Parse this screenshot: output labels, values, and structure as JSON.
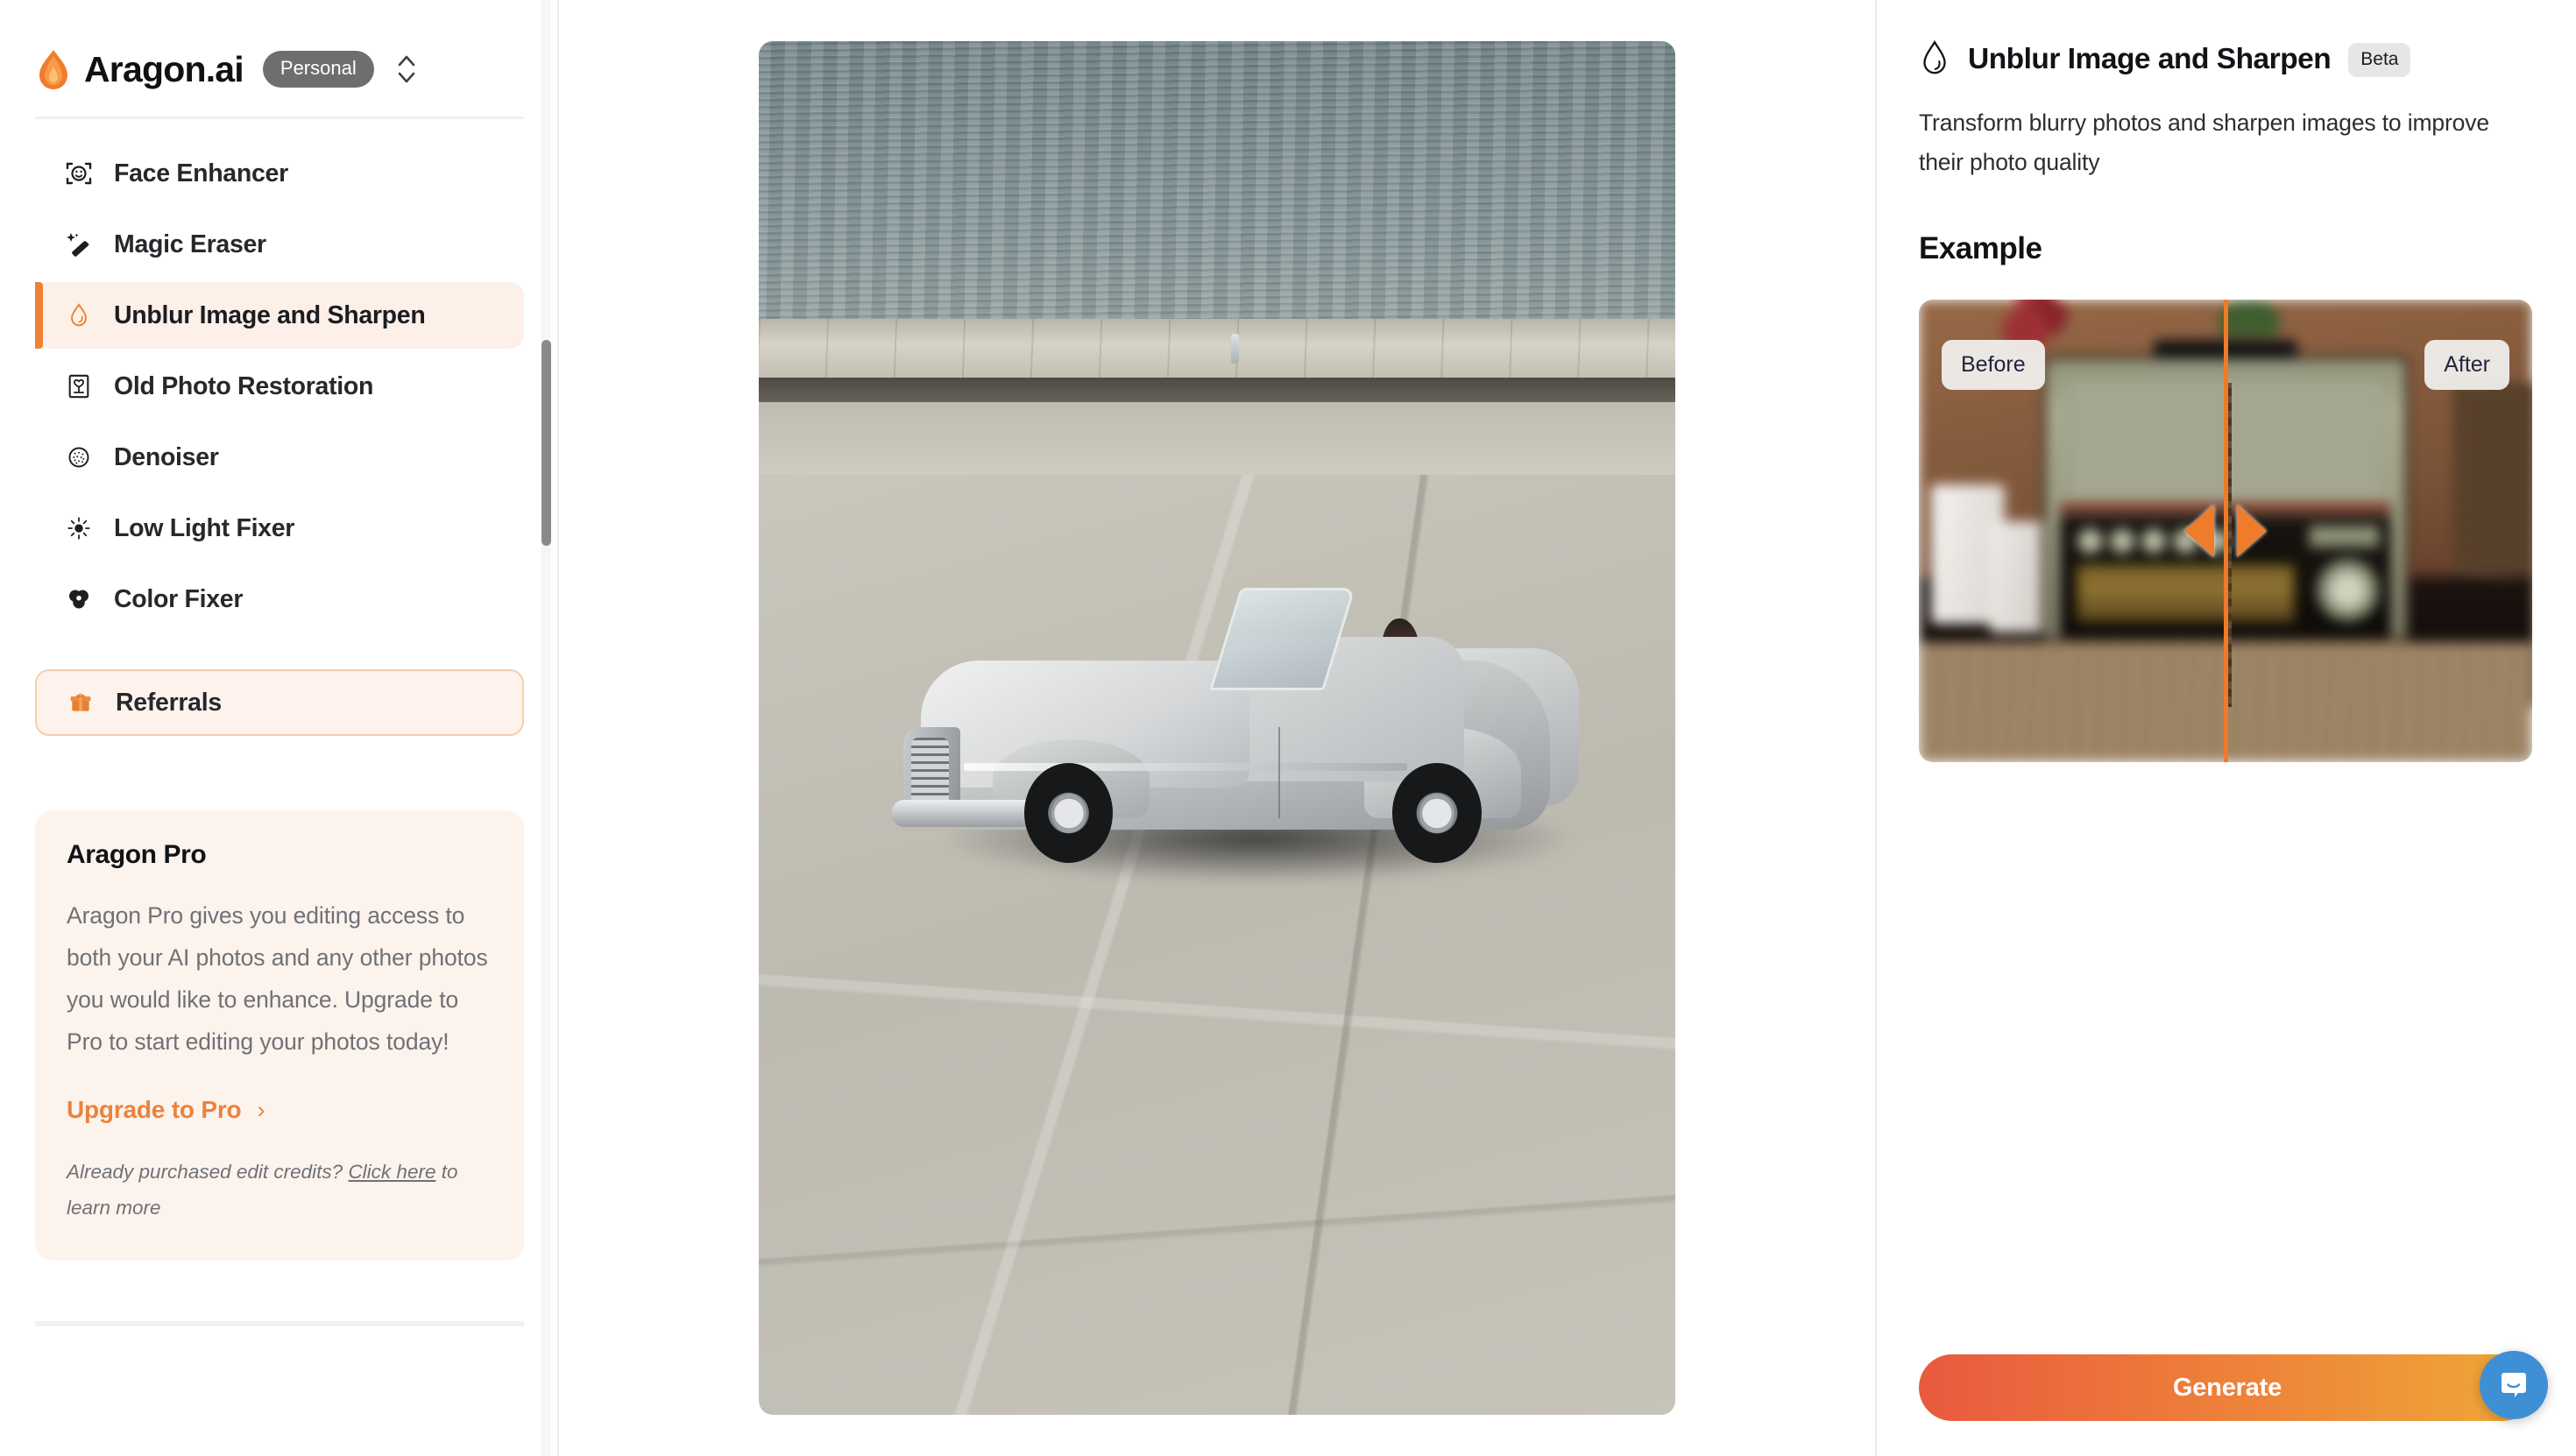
{
  "sidebar": {
    "brand": {
      "name": "Aragon.ai",
      "logo_icon": "flame-icon",
      "plan_badge": "Personal",
      "switcher_icon": "chevron-up-down-icon"
    },
    "nav_items": [
      {
        "label": "Face Enhancer",
        "icon": "face-scan-icon",
        "active": false
      },
      {
        "label": "Magic Eraser",
        "icon": "magic-wand-icon",
        "active": false
      },
      {
        "label": "Unblur Image and Sharpen",
        "icon": "water-drop-icon",
        "active": true
      },
      {
        "label": "Old Photo Restoration",
        "icon": "framed-flower-photo-icon",
        "active": false
      },
      {
        "label": "Denoiser",
        "icon": "noise-circle-icon",
        "active": false
      },
      {
        "label": "Low Light Fixer",
        "icon": "sun-icon",
        "active": false
      },
      {
        "label": "Color Fixer",
        "icon": "color-wheel-icon",
        "active": false
      }
    ],
    "referrals": {
      "label": "Referrals",
      "icon": "gift-icon"
    },
    "pro_card": {
      "title": "Aragon Pro",
      "body": "Aragon Pro gives you editing access to both your AI photos and any other photos you would like to enhance. Upgrade to Pro to start editing your photos today!",
      "upgrade_label": "Upgrade to Pro",
      "upgrade_chevron": "›",
      "fine_print_before": "Already purchased edit credits? ",
      "fine_print_link": "Click here",
      "fine_print_after": " to learn more"
    }
  },
  "canvas": {
    "photo_alt": "Vintage silver convertible car with a man in white driving along a seaside promenade"
  },
  "right_panel": {
    "title": "Unblur Image and Sharpen",
    "title_icon": "water-drop-icon",
    "badge": "Beta",
    "description": "Transform blurry photos and sharpen images to improve their photo quality",
    "example_heading": "Example",
    "example": {
      "before_label": "Before",
      "after_label": "After",
      "slider_left_icon": "triangle-left-icon",
      "slider_right_icon": "triangle-right-icon",
      "image_alt": "Vintage green radio on a wooden plank with candles, comparison of blurry and sharpened halves"
    },
    "generate_label": "Generate"
  },
  "chat": {
    "icon": "intercom-chat-icon"
  },
  "colors": {
    "accent_orange": "#ed8338",
    "accent_orange_light": "#fcf0e8",
    "pro_card_bg": "#fdf3ed",
    "slider_orange": "#ef7b28",
    "generate_gradient_start": "#e9593f",
    "generate_gradient_end": "#efa838",
    "chat_blue": "#3f8fd4",
    "badge_gray": "#6e6e6e",
    "beta_gray": "#e6e6e6",
    "text_dark": "#111317",
    "text_muted": "#6f7175"
  }
}
